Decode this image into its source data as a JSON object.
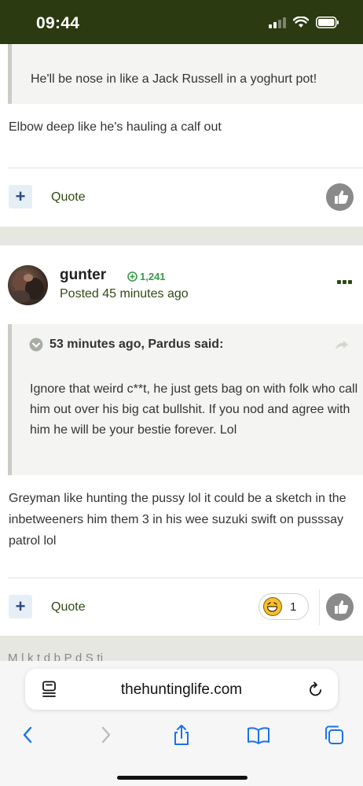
{
  "status_bar": {
    "time": "09:44"
  },
  "post_previous": {
    "quote_text": "He'll be nose in like a Jack Russell in a yoghurt pot!",
    "body": "Elbow deep like he's hauling a calf out",
    "actions": {
      "add_label": "+",
      "quote_label": "Quote"
    }
  },
  "post_main": {
    "author": "gunter",
    "reputation": "1,241",
    "posted": "Posted 45 minutes ago",
    "quote": {
      "header": "53 minutes ago, Pardus said:",
      "text": "Ignore that weird c**t, he just gets bag on with folk who call him out over his big cat bullshit. If you nod and agree with him he will be your bestie forever. Lol"
    },
    "body": "Greyman like hunting the pussy lol it could be a sketch in the inbetweeners him them 3 in his wee suzuki swift on pusssay patrol lol",
    "actions": {
      "add_label": "+",
      "quote_label": "Quote",
      "reaction_count": "1"
    }
  },
  "next_post_peek": "M    l     k                          t    d b  P  d    S  ti",
  "browser": {
    "url": "thehuntinglife.com"
  },
  "colors": {
    "header_bg": "#2b3a10",
    "accent_green": "#2f4a14",
    "rep_green": "#3a9a4a",
    "ios_blue": "#1a73e8"
  }
}
